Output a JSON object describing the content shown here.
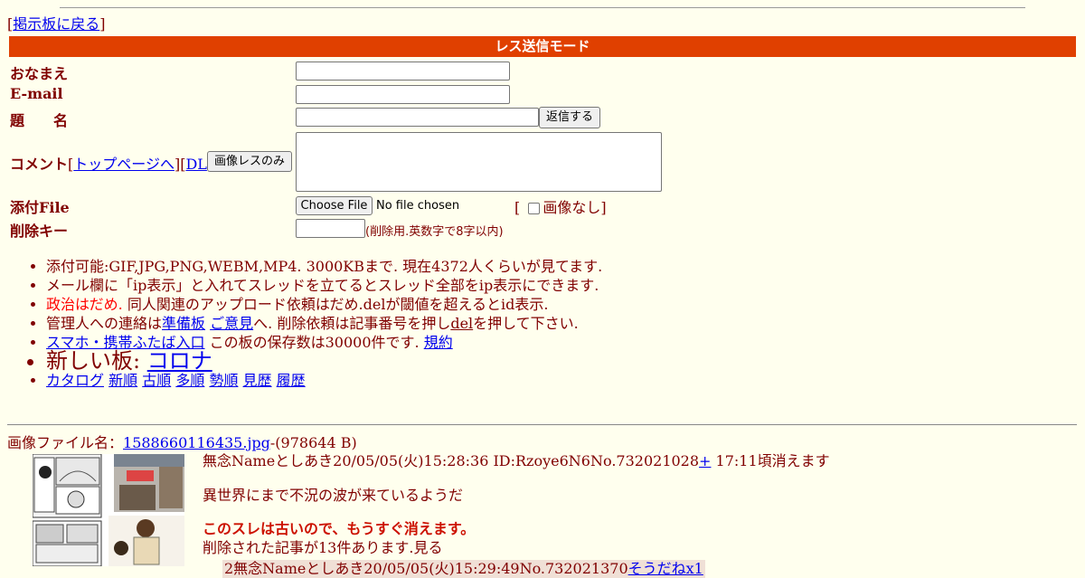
{
  "nav": {
    "back_prefix": "[",
    "back_link": "掲示板に戻る",
    "back_suffix": "]"
  },
  "form": {
    "mode_title": "レス送信モード",
    "name_label": "おなまえ",
    "email_label": "E-mail",
    "subject_label": "題　　名",
    "submit_label": "返信する",
    "comment_label": "コメント",
    "comment_link_open": "[",
    "comment_link_top": "トップページへ",
    "comment_link_mid": "][",
    "comment_link_dl": "DL",
    "comment_link_close": "]",
    "image_only_label": "画像レスのみ",
    "file_label": "添付File",
    "file_button": "Choose File",
    "file_status": "No file chosen",
    "noimage_open": "[",
    "noimage_label": "画像なし]",
    "delkey_label": "削除キー",
    "delkey_note": "(削除用.英数字で8字以内)"
  },
  "rules": {
    "r1": "添付可能:GIF,JPG,PNG,WEBM,MP4. 3000KBまで. 現在4372人くらいが見てます.",
    "r2": "メール欄に「ip表示」と入れてスレッドを立てるとスレッド全部をip表示にできます.",
    "r3_red": "政治はだめ.",
    "r3_rest": " 同人関連のアップロード依頼はだめ.delが閾値を超えるとid表示.",
    "r4_a": "管理人への連絡は",
    "r4_link1": "準備板",
    "r4_sp": " ",
    "r4_link2": "ご意見",
    "r4_b": "へ. 削除依頼は記事番号を押し",
    "r4_del": "del",
    "r4_c": "を押して下さい.",
    "r5_link": "スマホ・携帯ふたば入口",
    "r5_text": " この板の保存数は30000件です. ",
    "r5_link2": "規約",
    "r6_text": "新しい板: ",
    "r6_link": "コロナ",
    "r7": [
      "カタログ",
      "新順",
      "古順",
      "多順",
      "勢順",
      "見歴",
      "履歴"
    ]
  },
  "thread": {
    "img_prefix": "画像ファイル名：",
    "img_link": "1588660116435.jpg",
    "img_size": "-(978644 B)",
    "header": "無念Nameとしあき20/05/05(火)15:28:36 ID:Rzoye6N6No.732021028",
    "plus": "+",
    "expire": " 17:11頃消えます",
    "body": "異世界にまで不況の波が来ているようだ",
    "warning": "このスレは古いので、もうすぐ消えます。",
    "deleted": "削除された記事が13件あります.見る",
    "reply_header": "2無念Nameとしあき20/05/05(火)15:29:49No.732021370",
    "reply_soudane": "そうだねx1"
  }
}
